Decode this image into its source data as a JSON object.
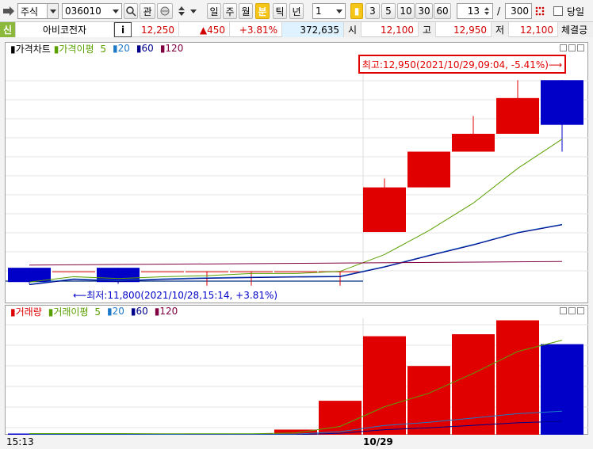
{
  "toolbar": {
    "market_select": "주식",
    "code_input": "036010",
    "search_btn": "⌕",
    "interest_btn": "관",
    "period_buttons": [
      "일",
      "주",
      "월",
      "분",
      "틱",
      "년"
    ],
    "active_period": "분",
    "interval_value": "1",
    "interval_buttons": [
      "3",
      "5",
      "10",
      "30",
      "60"
    ],
    "active_interval_marker": "▮",
    "count_value": "13",
    "count_sep": "/",
    "total_value": "300",
    "today_label": "당일"
  },
  "quote": {
    "credit_badge": "신",
    "stock_name": "아비코전자",
    "info_btn": "i",
    "price": "12,250",
    "change": "▲450",
    "change_pct": "+3.81%",
    "volume": "372,635",
    "open_label": "시",
    "open": "12,100",
    "high_label": "고",
    "high": "12,950",
    "low_label": "저",
    "low": "12,100",
    "trade_label": "체결긍"
  },
  "price_pane": {
    "legend": [
      "가격차트",
      "가격이평",
      "5",
      "20",
      "60",
      "120"
    ],
    "max_note": "최고:12,950(2021/10/29,09:04, -5.41%)⟶",
    "min_note": "⟵최저:11,800(2021/10/28,15:14, +3.81%)"
  },
  "volume_pane": {
    "legend": [
      "거래량",
      "거래이평",
      "5",
      "20",
      "60",
      "120"
    ]
  },
  "axis": {
    "left_time": "15:13",
    "date_label": "10/29"
  },
  "colors": {
    "up": "#e00000",
    "down": "#0000c8",
    "ma5": "#5aa000",
    "ma20": "#1e78c8",
    "ma60": "#00008c",
    "ma120": "#800040",
    "highlight": "#e00000"
  },
  "chart_data": {
    "type": "candlestick",
    "candles": [
      {
        "o": 11900,
        "h": 11900,
        "l": 11810,
        "c": 11820
      },
      {
        "o": 11880,
        "h": 11880,
        "l": 11880,
        "c": 11880
      },
      {
        "o": 11900,
        "h": 11900,
        "l": 11810,
        "c": 11820
      },
      {
        "o": 11880,
        "h": 11880,
        "l": 11880,
        "c": 11880
      },
      {
        "o": 11880,
        "h": 11880,
        "l": 11800,
        "c": 11880
      },
      {
        "o": 11880,
        "h": 11880,
        "l": 11800,
        "c": 11880
      },
      {
        "o": 11880,
        "h": 11880,
        "l": 11880,
        "c": 11880
      },
      {
        "o": 11880,
        "h": 11880,
        "l": 11800,
        "c": 11880
      },
      {
        "o": 12100,
        "h": 12400,
        "l": 12100,
        "c": 12350
      },
      {
        "o": 12350,
        "h": 12550,
        "l": 12350,
        "c": 12550
      },
      {
        "o": 12550,
        "h": 12750,
        "l": 12550,
        "c": 12650
      },
      {
        "o": 12650,
        "h": 12950,
        "l": 12650,
        "c": 12850
      },
      {
        "o": 12950,
        "h": 12950,
        "l": 12550,
        "c": 12700
      }
    ],
    "volume": [
      2,
      2,
      2,
      1,
      2,
      2,
      6,
      35,
      100,
      70,
      102,
      116,
      92
    ]
  }
}
